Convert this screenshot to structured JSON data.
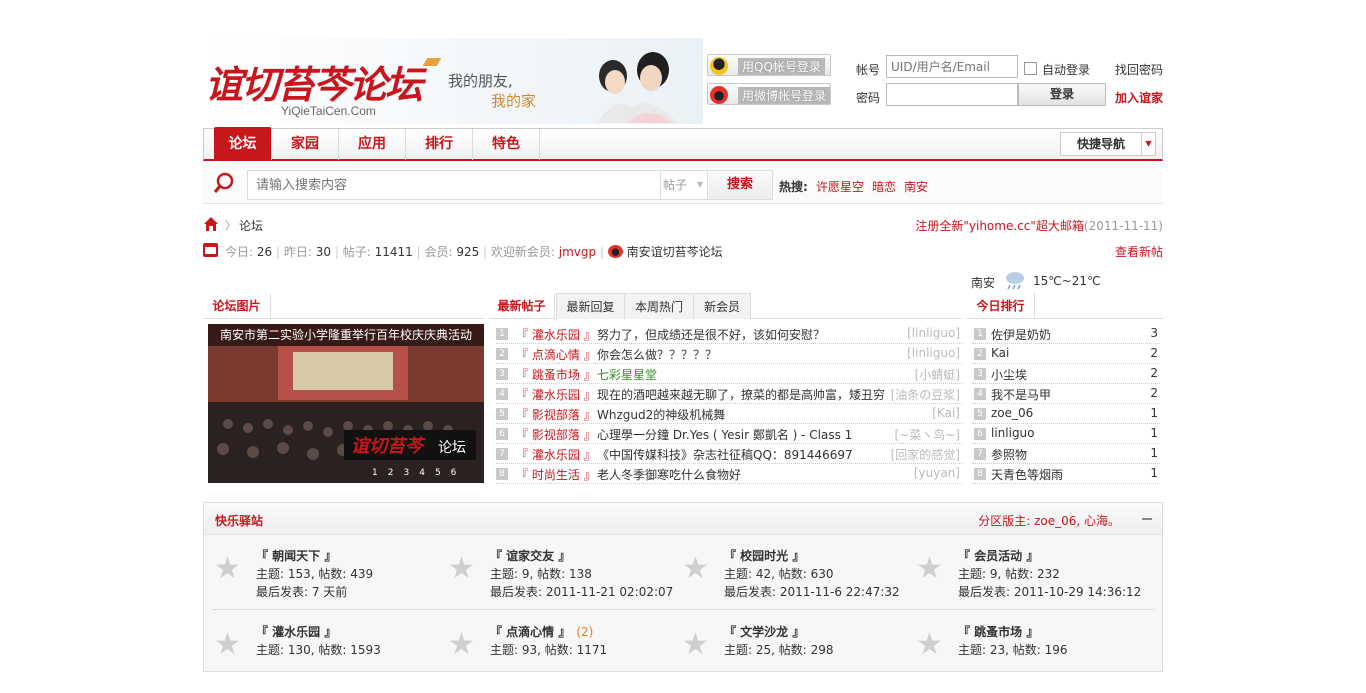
{
  "header": {
    "logo": "谊切苔芩论坛",
    "logo_sub": "YiQieTaiCen.Com",
    "slogan_line1": "我的朋友,",
    "slogan_line2": "我的家",
    "qq_login": "用QQ帐号登录",
    "weibo_login": "用微博帐号登录",
    "account_label": "帐号",
    "account_placeholder": "UID/用户名/Email",
    "auto_login": "自动登录",
    "find_password": "找回密码",
    "password_label": "密码",
    "login_button": "登录",
    "join": "加入谊家"
  },
  "nav": {
    "items": [
      "论坛",
      "家园",
      "应用",
      "排行",
      "特色"
    ],
    "quick_nav": "快捷导航"
  },
  "search": {
    "placeholder": "请输入搜索内容",
    "type": "帖子",
    "button": "搜索",
    "hot_label": "热搜:",
    "hot_tags": [
      "许愿星空",
      "暗恋",
      "南安"
    ]
  },
  "breadcrumb": {
    "current": "论坛",
    "notice": "注册全新\"yihome.cc\"超大邮箱",
    "notice_date": "(2011-11-11)"
  },
  "stats": {
    "today_label": "今日:",
    "today": "26",
    "yesterday_label": "昨日:",
    "yesterday": "30",
    "posts_label": "帖子:",
    "posts": "11411",
    "members_label": "会员:",
    "members": "925",
    "welcome_label": "欢迎新会员:",
    "new_member": "jmvgp",
    "weibo_name": "南安谊切苔芩论坛",
    "view_new": "查看新帖"
  },
  "weather": {
    "city": "南安",
    "temp": "15℃~21℃"
  },
  "panels": {
    "pictures_title": "论坛图片",
    "picture_caption": "南安市第二实验小学隆重举行百年校庆庆典活动",
    "picture_pager": [
      "1",
      "2",
      "3",
      "4",
      "5",
      "6"
    ],
    "tabs": [
      "最新帖子",
      "最新回复",
      "本周热门",
      "新会员"
    ],
    "ranking_title": "今日排行"
  },
  "threads": [
    {
      "num": "1",
      "cat": "『 灌水乐园 』",
      "title": "努力了，但成绩还是很不好，该如何安慰？",
      "author": "[linliguo]",
      "green": false
    },
    {
      "num": "2",
      "cat": "『 点滴心情 』",
      "title": "你会怎么做？？？？？",
      "author": "[linliguo]",
      "green": false
    },
    {
      "num": "3",
      "cat": "『 跳蚤市场 』",
      "title": "七彩星星堂",
      "author": "[小蜻蜓]",
      "green": true
    },
    {
      "num": "4",
      "cat": "『 灌水乐园 』",
      "title": "现在的酒吧越来越无聊了，撩菜的都是高帅富，矮丑穷",
      "author": "[油条の豆浆]",
      "green": false
    },
    {
      "num": "5",
      "cat": "『 影视部落 』",
      "title": "Whzgud2的神级机械舞",
      "author": "[Kai]",
      "green": false
    },
    {
      "num": "6",
      "cat": "『 影视部落 』",
      "title": "心理學一分鐘 Dr.Yes ( Yesir 鄭凱名 ) - Class 1",
      "author": "[~菜ヽ鸟~]",
      "green": false
    },
    {
      "num": "7",
      "cat": "『 灌水乐园 』",
      "title": "《中国传媒科技》杂志社征稿QQ：891446697",
      "author": "[回家的感觉]",
      "green": false
    },
    {
      "num": "8",
      "cat": "『 时尚生活 』",
      "title": "老人冬季御寒吃什么食物好",
      "author": "[yuyan]",
      "green": false
    }
  ],
  "ranking": [
    {
      "num": "1",
      "name": "佐伊是奶奶",
      "count": "3"
    },
    {
      "num": "2",
      "name": "Kai",
      "count": "2"
    },
    {
      "num": "3",
      "name": "小尘埃",
      "count": "2"
    },
    {
      "num": "4",
      "name": "我不是马甲",
      "count": "2"
    },
    {
      "num": "5",
      "name": "zoe_06",
      "count": "1"
    },
    {
      "num": "6",
      "name": "linliguo",
      "count": "1"
    },
    {
      "num": "7",
      "name": "参照物",
      "count": "1"
    },
    {
      "num": "8",
      "name": "天青色等烟雨",
      "count": "1"
    }
  ],
  "section": {
    "title": "快乐驿站",
    "moderator": "分区版主: zoe_06, 心海。",
    "forums": [
      {
        "name": "『 朝闻天下 』",
        "new": "",
        "stat": "主题: 153, 帖数: 439",
        "last": "最后发表: 7 天前"
      },
      {
        "name": "『 谊家交友 』",
        "new": "",
        "stat": "主题: 9, 帖数: 138",
        "last": "最后发表: 2011-11-21 02:02:07"
      },
      {
        "name": "『 校园时光 』",
        "new": "",
        "stat": "主题: 42, 帖数: 630",
        "last": "最后发表: 2011-11-6 22:47:32"
      },
      {
        "name": "『 会员活动 』",
        "new": "",
        "stat": "主题: 9, 帖数: 232",
        "last": "最后发表: 2011-10-29 14:36:12"
      },
      {
        "name": "『 灌水乐园 』",
        "new": "",
        "stat": "主题: 130, 帖数: 1593",
        "last": ""
      },
      {
        "name": "『 点滴心情 』",
        "new": "(2)",
        "stat": "主题: 93, 帖数: 1171",
        "last": ""
      },
      {
        "name": "『 文学沙龙 』",
        "new": "",
        "stat": "主题: 25, 帖数: 298",
        "last": ""
      },
      {
        "name": "『 跳蚤市场 』",
        "new": "",
        "stat": "主题: 23, 帖数: 196",
        "last": ""
      }
    ]
  },
  "colors": {
    "brand_red": "#c8161d",
    "muted_grey": "#999999",
    "new_post_orange": "#e67e22",
    "green_title": "#3a8e2a"
  }
}
